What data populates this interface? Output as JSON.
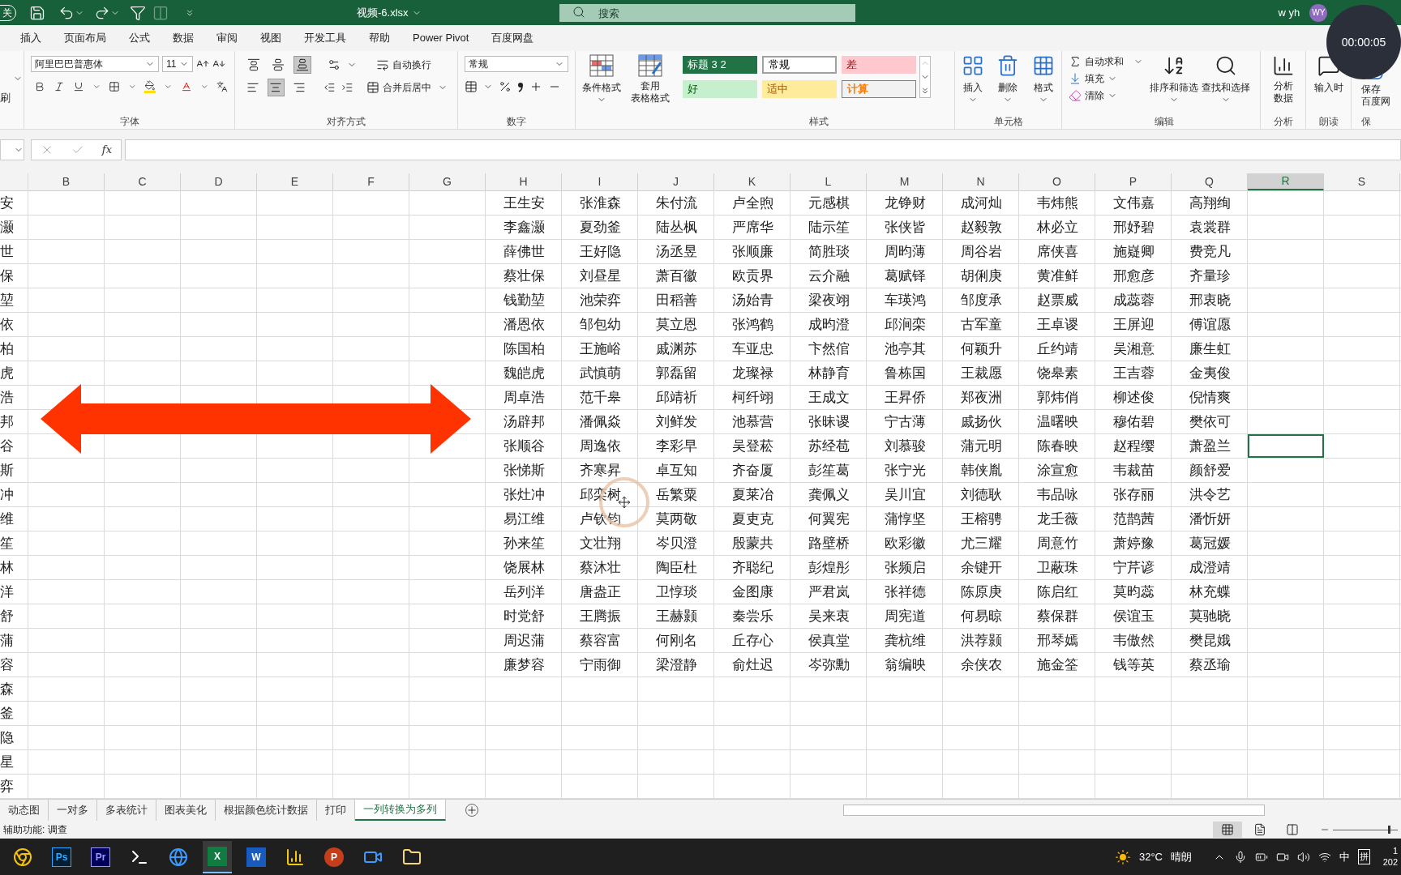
{
  "title_bar": {
    "autosave": "关",
    "filename": "视频-6.xlsx",
    "search_placeholder": "搜索",
    "user_name": "w yh",
    "avatar": "WY"
  },
  "recording_timer": "00:00:05",
  "menu_tabs": [
    "插入",
    "页面布局",
    "公式",
    "数据",
    "审阅",
    "视图",
    "开发工具",
    "帮助",
    "Power Pivot",
    "百度网盘"
  ],
  "ribbon": {
    "format_painter_cut": "刷",
    "font": {
      "name": "阿里巴巴普惠体",
      "size": "11",
      "label": "字体"
    },
    "alignment": {
      "vertical": [
        {
          "selected": false
        },
        {
          "selected": false
        },
        {
          "selected": true
        }
      ],
      "horizontal": [
        {
          "selected": false
        },
        {
          "selected": true
        },
        {
          "selected": false
        }
      ],
      "wrap": "自动换行",
      "merge": "合并后居中",
      "label": "对齐方式"
    },
    "number": {
      "format": "常规",
      "label": "数字"
    },
    "conditional_format": "条件格式",
    "table_format": [
      "套用",
      "表格格式"
    ],
    "styles": {
      "items": [
        {
          "label": "标题 3 2",
          "kind": "heading"
        },
        {
          "label": "常规",
          "kind": "normal"
        },
        {
          "label": "差",
          "kind": "bad"
        },
        {
          "label": "好",
          "kind": "good"
        },
        {
          "label": "适中",
          "kind": "neutral"
        },
        {
          "label": "计算",
          "kind": "calculation"
        }
      ],
      "label": "样式"
    },
    "cells": {
      "buttons": [
        "插入",
        "删除",
        "格式"
      ],
      "label": "单元格"
    },
    "editing": {
      "autosum": "自动求和",
      "fill": "填充",
      "clear": "清除",
      "sort": "排序和筛选",
      "find": "查找和选择",
      "label": "编辑"
    },
    "analysis": {
      "button": [
        "分析",
        "数据"
      ],
      "label": "分析"
    },
    "read_aloud": {
      "button": "输入时",
      "label": "朗读"
    },
    "save": {
      "button": [
        "保存",
        "百度网"
      ],
      "label": "保"
    }
  },
  "formula_bar": {
    "fx": "fx"
  },
  "columns": [
    {
      "label": "B",
      "selected": false
    },
    {
      "label": "C",
      "selected": false
    },
    {
      "label": "D",
      "selected": false
    },
    {
      "label": "E",
      "selected": false
    },
    {
      "label": "F",
      "selected": false
    },
    {
      "label": "G",
      "selected": false
    },
    {
      "label": "H",
      "selected": false
    },
    {
      "label": "I",
      "selected": false
    },
    {
      "label": "J",
      "selected": false
    },
    {
      "label": "K",
      "selected": false
    },
    {
      "label": "L",
      "selected": false
    },
    {
      "label": "M",
      "selected": false
    },
    {
      "label": "N",
      "selected": false
    },
    {
      "label": "O",
      "selected": false
    },
    {
      "label": "P",
      "selected": false
    },
    {
      "label": "Q",
      "selected": false
    },
    {
      "label": "R",
      "selected": true
    },
    {
      "label": "S",
      "selected": false
    }
  ],
  "rows": [
    {
      "column_a": "安",
      "cells": [
        "王生安",
        "张淮森",
        "朱付流",
        "卢全煦",
        "元感棋",
        "龙铮财",
        "成河灿",
        "韦炜熊",
        "文伟嘉",
        "高翔绚"
      ],
      "selected": false
    },
    {
      "column_a": "灏",
      "cells": [
        "李鑫灏",
        "夏劲釜",
        "陆丛枫",
        "严席华",
        "陆示笙",
        "张侠皆",
        "赵毅敦",
        "林必立",
        "邢妤碧",
        "袁裳群"
      ],
      "selected": false
    },
    {
      "column_a": "世",
      "cells": [
        "薛佛世",
        "王好隐",
        "汤丞昱",
        "张顺廉",
        "简胜琰",
        "周昀薄",
        "周谷岩",
        "席侠喜",
        "施嶷卿",
        "费竞凡"
      ],
      "selected": false
    },
    {
      "column_a": "保",
      "cells": [
        "蔡壮保",
        "刘昼星",
        "萧百徽",
        "欧贡界",
        "云介融",
        "葛赋铎",
        "胡俐庚",
        "黄准鲜",
        "邢愈彦",
        "齐量珍"
      ],
      "selected": false
    },
    {
      "column_a": "堃",
      "cells": [
        "钱勤堃",
        "池荣弈",
        "田稻善",
        "汤始青",
        "梁夜翊",
        "车瑛鸿",
        "邹度承",
        "赵票威",
        "成蕊蓉",
        "邢衷晓"
      ],
      "selected": false
    },
    {
      "column_a": "依",
      "cells": [
        "潘恩依",
        "邹包幼",
        "莫立恩",
        "张鸿鹤",
        "成昀澄",
        "邱涧栾",
        "古军童",
        "王卓谡",
        "王屏迎",
        "傅谊愿"
      ],
      "selected": false
    },
    {
      "column_a": "柏",
      "cells": [
        "陈国柏",
        "王施峪",
        "戚渊苏",
        "车亚忠",
        "卞然倌",
        "池亭其",
        "何颖升",
        "丘约靖",
        "吴湘意",
        "廉生虹"
      ],
      "selected": false
    },
    {
      "column_a": "虎",
      "cells": [
        "魏皑虎",
        "武慎萌",
        "郭磊留",
        "龙璨禄",
        "林静育",
        "鲁栋国",
        "王裁愿",
        "饶皋素",
        "王吉蓉",
        "金夷俊"
      ],
      "selected": false
    },
    {
      "column_a": "浩",
      "cells": [
        "周卓浩",
        "范千皋",
        "邱靖祈",
        "柯纤翊",
        "王成文",
        "王昇侨",
        "郑夜洲",
        "郭炜俏",
        "柳述俊",
        "倪情爽"
      ],
      "selected": false
    },
    {
      "column_a": "邦",
      "cells": [
        "汤辟邦",
        "潘佩焱",
        "刘鲜发",
        "池慕营",
        "张昧谡",
        "宁古薄",
        "戚扬伙",
        "温曙映",
        "穆佑碧",
        "樊依可"
      ],
      "selected": false
    },
    {
      "column_a": "谷",
      "cells": [
        "张顺谷",
        "周逸依",
        "李彩早",
        "吴登菘",
        "苏经苞",
        "刘慕骏",
        "蒲元明",
        "陈春映",
        "赵程缨",
        "萧盈兰"
      ],
      "selected": true
    },
    {
      "column_a": "斯",
      "cells": [
        "张悌斯",
        "齐寒昇",
        "卓互知",
        "齐奋厦",
        "彭笙葛",
        "张宁光",
        "韩侠胤",
        "涂宣愈",
        "韦裁苗",
        "颜舒爱"
      ],
      "selected": false
    },
    {
      "column_a": "冲",
      "cells": [
        "张灶冲",
        "邱栾树",
        "岳繁粟",
        "夏莱冶",
        "龚佩义",
        "吴川宜",
        "刘德耿",
        "韦品咏",
        "张存丽",
        "洪令艺"
      ],
      "selected": false
    },
    {
      "column_a": "维",
      "cells": [
        "易江维",
        "卢钦钧",
        "莫两敬",
        "夏吏克",
        "何翼宪",
        "蒲惇坚",
        "王榕骋",
        "龙壬薇",
        "范鹊茜",
        "潘忻妍"
      ],
      "selected": false
    },
    {
      "column_a": "笙",
      "cells": [
        "孙来笙",
        "文壮翔",
        "岑贝澄",
        "殷蒙共",
        "路壁桥",
        "欧彩徽",
        "尤三耀",
        "周意竹",
        "萧婷豫",
        "葛冠媛"
      ],
      "selected": false
    },
    {
      "column_a": "林",
      "cells": [
        "饶展林",
        "蔡沐壮",
        "陶臣杜",
        "齐聪纪",
        "彭煌彤",
        "张频启",
        "余键开",
        "卫蔽珠",
        "宁芹谚",
        "成澄靖"
      ],
      "selected": false
    },
    {
      "column_a": "洋",
      "cells": [
        "岳列洋",
        "唐盎正",
        "卫惇琰",
        "金图康",
        "严君岚",
        "张祥德",
        "陈原庚",
        "陈启红",
        "莫昀蕊",
        "林充蝶"
      ],
      "selected": false
    },
    {
      "column_a": "舒",
      "cells": [
        "时党舒",
        "王腾振",
        "王赫颢",
        "秦尝乐",
        "吴来衷",
        "周宪道",
        "何易晾",
        "蔡保群",
        "侯谊玉",
        "莫驰晓"
      ],
      "selected": false
    },
    {
      "column_a": "蒲",
      "cells": [
        "周迟蒲",
        "蔡容富",
        "何刚名",
        "丘存心",
        "侯真堂",
        "龚杭维",
        "洪荐颢",
        "邢琴嫣",
        "韦傲然",
        "樊昆娥"
      ],
      "selected": false
    },
    {
      "column_a": "容",
      "cells": [
        "廉梦容",
        "宁雨御",
        "梁澄静",
        "俞灶迟",
        "岑弥勳",
        "翁编映",
        "余侠农",
        "施金筌",
        "钱等英",
        "蔡丞瑜"
      ],
      "selected": false
    },
    {
      "column_a": "森",
      "selected": false
    },
    {
      "column_a": "釜",
      "selected": false
    },
    {
      "column_a": "隐",
      "selected": false
    },
    {
      "column_a": "星",
      "selected": false
    },
    {
      "column_a": "弈",
      "selected": false
    }
  ],
  "sheet_tabs": [
    {
      "label": "动态图",
      "selected": false
    },
    {
      "label": "一对多",
      "selected": false
    },
    {
      "label": "多表统计",
      "selected": false
    },
    {
      "label": "图表美化",
      "selected": false
    },
    {
      "label": "根据颜色统计数据",
      "selected": false
    },
    {
      "label": "打印",
      "selected": false
    },
    {
      "label": "一列转换为多列",
      "selected": true
    }
  ],
  "status_bar": {
    "text": "辅助功能: 调查",
    "views": [
      {
        "selected": true
      },
      {
        "selected": false
      },
      {
        "selected": false
      }
    ],
    "zoom": {
      "level": 0.85
    }
  },
  "taskbar": {
    "apps": [
      {
        "kind": "chrome",
        "selected": false
      },
      {
        "kind": "photoshop",
        "label": "Ps",
        "selected": false
      },
      {
        "kind": "premiere",
        "label": "Pr",
        "selected": false
      },
      {
        "kind": "terminal",
        "selected": false
      },
      {
        "kind": "browser",
        "selected": false
      },
      {
        "kind": "excel",
        "label": "X",
        "selected": true
      },
      {
        "kind": "word",
        "label": "W",
        "selected": false
      },
      {
        "kind": "powerbi",
        "selected": false
      },
      {
        "kind": "powerpoint",
        "label": "P",
        "selected": false
      },
      {
        "kind": "video",
        "selected": false
      },
      {
        "kind": "folder",
        "selected": false
      }
    ],
    "weather": {
      "temp": "32°C",
      "condition": "晴朗"
    },
    "ime": [
      "中",
      "拼"
    ],
    "clock": [
      "1",
      "202"
    ]
  }
}
